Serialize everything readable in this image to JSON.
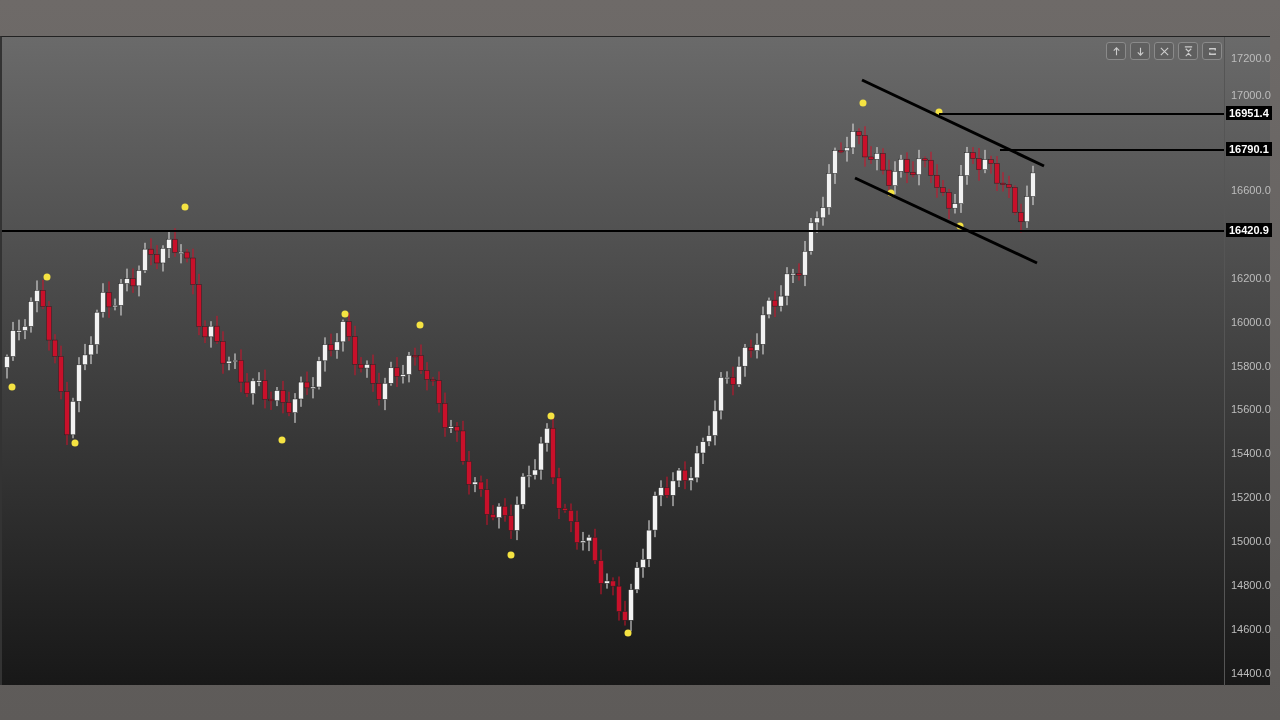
{
  "toolbar": {
    "buttons": [
      {
        "kind": "up"
      },
      {
        "kind": "down"
      },
      {
        "kind": "close"
      },
      {
        "kind": "collapse"
      },
      {
        "kind": "cycle"
      }
    ]
  },
  "price_axis": {
    "ticks": [
      "17200.0",
      "17000.0",
      "16600.0",
      "16200.0",
      "16000.0",
      "15800.0",
      "15600.0",
      "15400.0",
      "15200.0",
      "15000.0",
      "14800.0",
      "14600.0",
      "14400.0"
    ]
  },
  "price_lines": [
    {
      "label": "16951.4"
    },
    {
      "label": "16790.1"
    },
    {
      "label": "16420.9"
    }
  ]
}
